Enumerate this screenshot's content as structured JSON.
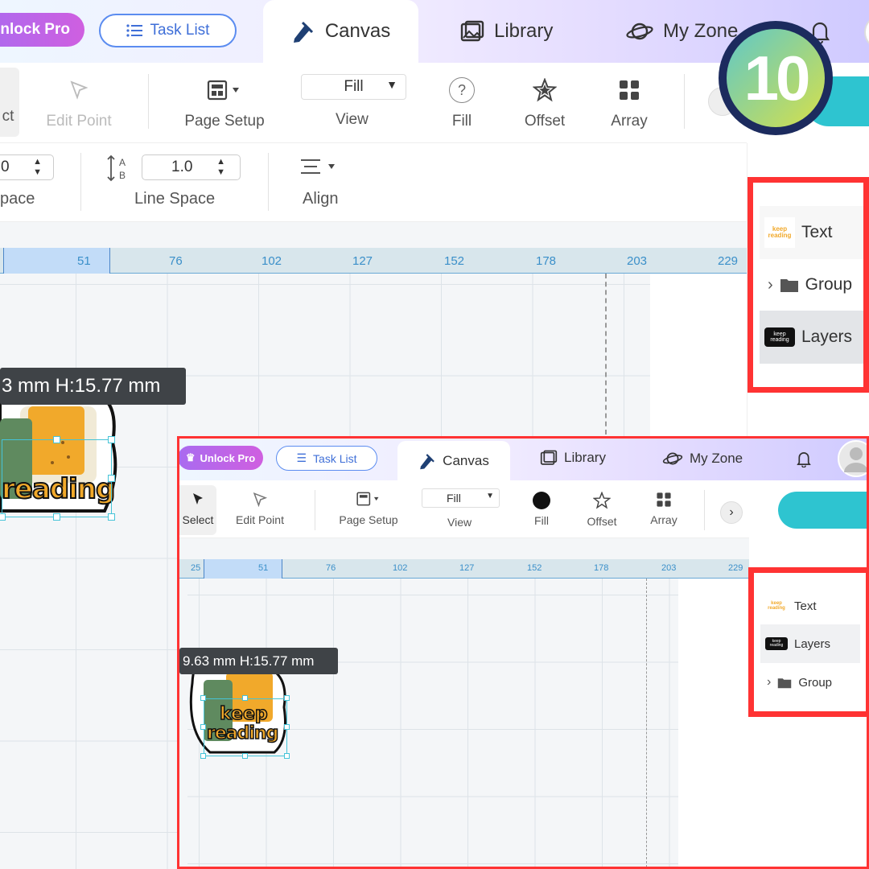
{
  "tabbar": {
    "unlock_label": "Unlock Pro",
    "tasklist_label": "Task List",
    "tabs": [
      {
        "label": "Canvas",
        "active": true
      },
      {
        "label": "Library",
        "active": false
      },
      {
        "label": "My Zone",
        "active": false
      }
    ]
  },
  "step_badge": "10",
  "toolbar": {
    "select_label": "ct",
    "edit_point_label": "Edit Point",
    "page_setup_label": "Page Setup",
    "view_value": "Fill",
    "view_label": "View",
    "fill_label": "Fill",
    "offset_label": "Offset",
    "array_label": "Array"
  },
  "text_toolbar": {
    "space_value": "0",
    "space_label": "pace",
    "line_space_value": "1.0",
    "line_space_label": "Line Space",
    "align_label": "Align"
  },
  "ruler_ticks": [
    "51",
    "76",
    "102",
    "127",
    "152",
    "178",
    "203",
    "229"
  ],
  "dimension_label": "3 mm  H:15.77 mm",
  "sticker_text": "reading",
  "layers": [
    {
      "name": "Text",
      "thumb": "keep reading"
    },
    {
      "name": "Group"
    },
    {
      "name": "Layers",
      "thumb": "keep reading"
    }
  ],
  "inset": {
    "unlock_label": "Unlock Pro",
    "tasklist_label": "Task List",
    "tabs": [
      "Canvas",
      "Library",
      "My Zone"
    ],
    "select_label": "Select",
    "edit_point_label": "Edit Point",
    "page_setup_label": "Page Setup",
    "view_value": "Fill",
    "view_label": "View",
    "fill_label": "Fill",
    "offset_label": "Offset",
    "array_label": "Array",
    "ruler_ticks": [
      "25",
      "51",
      "76",
      "102",
      "127",
      "152",
      "178",
      "203",
      "229"
    ],
    "dimension_label": "9.63 mm  H:15.77 mm",
    "sticker_text_1": "keep",
    "sticker_text_2": "reading",
    "layers": [
      {
        "name": "Text",
        "thumb": "keep reading"
      },
      {
        "name": "Layers",
        "thumb": "keep reading"
      },
      {
        "name": "Group"
      }
    ]
  },
  "colors": {
    "accent": "#2ec4d0",
    "highlight_box": "#ff3333",
    "badge_dark": "#1c2b5e",
    "sticker_orange": "#f1a92b"
  }
}
